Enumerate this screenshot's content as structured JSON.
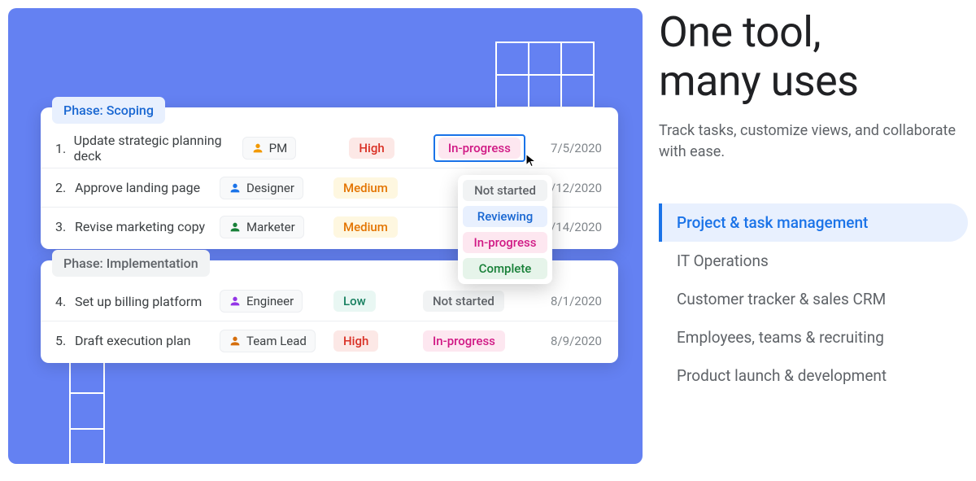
{
  "headline_line1": "One tool,",
  "headline_line2": "many uses",
  "subhead": "Track tasks, customize views, and collaborate with ease.",
  "use_cases": [
    "Project & task management",
    "IT Operations",
    "Customer tracker & sales CRM",
    "Employees, teams & recruiting",
    "Product launch & development"
  ],
  "phase1_label": "Phase: Scoping",
  "phase2_label": "Phase: Implementation",
  "rows": [
    {
      "n": "1.",
      "task": "Update strategic planning deck",
      "role": "PM",
      "role_color": "#f29900",
      "prio": "High",
      "prio_cls": "c-high",
      "status": "In-progress",
      "status_cls": "c-inprogress",
      "date": "7/5/2020"
    },
    {
      "n": "2.",
      "task": "Approve landing page",
      "role": "Designer",
      "role_color": "#1a73e8",
      "prio": "Medium",
      "prio_cls": "c-medium",
      "status": "",
      "status_cls": "",
      "date": "7/12/2020"
    },
    {
      "n": "3.",
      "task": "Revise marketing copy",
      "role": "Marketer",
      "role_color": "#188038",
      "prio": "Medium",
      "prio_cls": "c-medium",
      "status": "",
      "status_cls": "",
      "date": "7/14/2020"
    },
    {
      "n": "4.",
      "task": "Set up billing platform",
      "role": "Engineer",
      "role_color": "#9334e6",
      "prio": "Low",
      "prio_cls": "c-low",
      "status": "Not started",
      "status_cls": "c-notstarted",
      "date": "8/1/2020"
    },
    {
      "n": "5.",
      "task": "Draft execution plan",
      "role": "Team Lead",
      "role_color": "#d56e0c",
      "prio": "High",
      "prio_cls": "c-high",
      "status": "In-progress",
      "status_cls": "c-inprogress",
      "date": "8/9/2020"
    }
  ],
  "dropdown": [
    {
      "label": "Not started",
      "cls": "c-notstarted"
    },
    {
      "label": "Reviewing",
      "cls": "c-reviewing"
    },
    {
      "label": "In-progress",
      "cls": "c-inprogress"
    },
    {
      "label": "Complete",
      "cls": "c-complete"
    }
  ]
}
